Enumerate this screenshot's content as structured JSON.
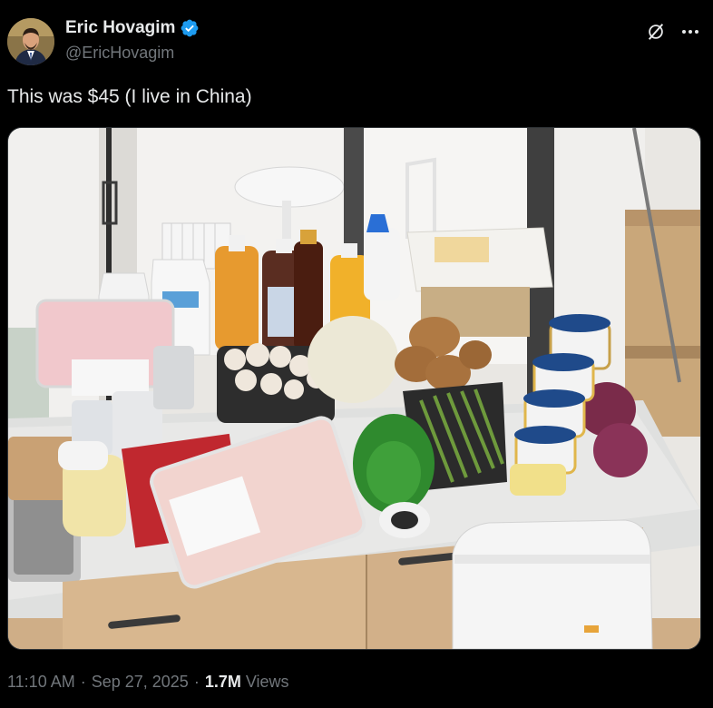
{
  "author": {
    "name": "Eric Hovagim",
    "handle": "@EricHovagim",
    "verified": true
  },
  "tweet": {
    "text": "This was $45 (I live in China)"
  },
  "media": {
    "description_icon": "photo"
  },
  "meta": {
    "time": "11:10 AM",
    "date": "Sep 27, 2025",
    "separator": "·",
    "views_count": "1.7M",
    "views_label": "Views"
  },
  "colors": {
    "background": "#000000",
    "text_primary": "#e7e9ea",
    "text_secondary": "#71767b",
    "verified_blue": "#1d9bf0"
  }
}
